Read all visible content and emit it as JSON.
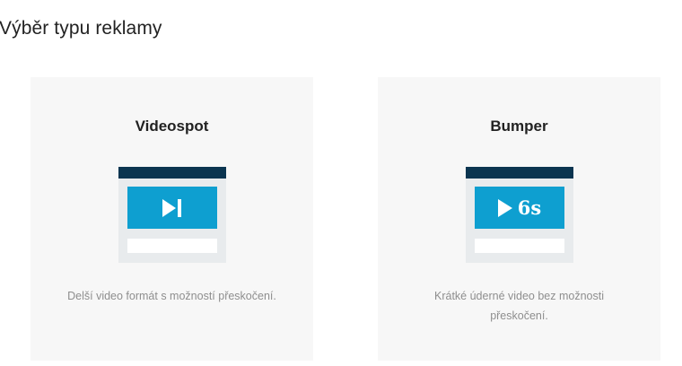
{
  "page": {
    "title": "Výběr typu reklamy"
  },
  "cards": [
    {
      "title": "Videospot",
      "icon": "skip-forward-icon",
      "description": "Delší video formát s možností přeskočení."
    },
    {
      "title": "Bumper",
      "icon": "play-icon",
      "duration_label": "6s",
      "description": "Krátké úderné video bez možnosti přeskočení."
    }
  ],
  "colors": {
    "card_bg": "#f7f7f7",
    "illustration_frame": "#e8ebed",
    "illustration_bar": "#0b3550",
    "illustration_screen": "#0e9fd0",
    "description_text": "#8e8e8e"
  }
}
